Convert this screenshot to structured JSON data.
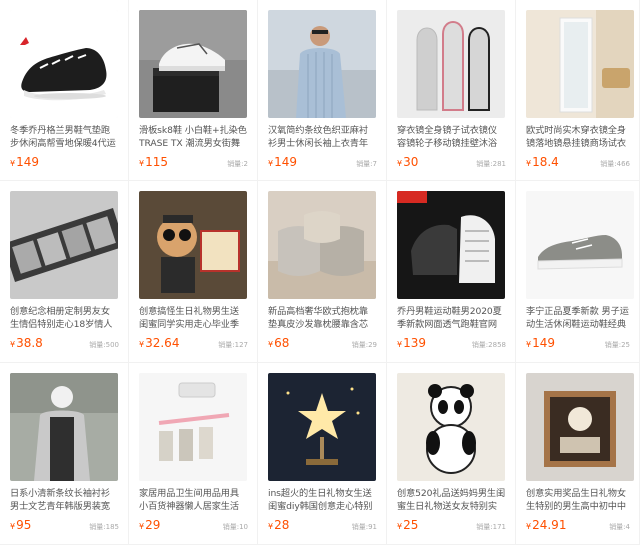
{
  "products": [
    {
      "title": "冬季乔丹格兰男鞋气垫跑步休闲高帮雪地保暖4代运动男加绒棉",
      "currency": "¥",
      "price": "149",
      "sales": ""
    },
    {
      "title": "滑板sk8鞋 小白鞋+扎染色TRASE TX 潮流男女街舞帆布休",
      "currency": "¥",
      "price": "115",
      "sales": "销量:2"
    },
    {
      "title": "汉氧简约条纹色织亚麻衬衫男士休闲长袖上衣青年棉麻修身型衬",
      "currency": "¥",
      "price": "149",
      "sales": "销量:7"
    },
    {
      "title": "穿衣镜全身镜子试衣镜仪容镜轮子移动镜挂壁沐浴镜简约现代经",
      "currency": "¥",
      "price": "30",
      "sales": "销量:281"
    },
    {
      "title": "欧式时尚实木穿衣镜全身镜落地镜悬挂镜商场试衣镜试鞋镜大壁",
      "currency": "¥",
      "price": "18.4",
      "sales": "销量:466"
    },
    {
      "title": "创意纪念相册定制男友女生情侣特别走心18岁情人抖音热门生",
      "currency": "¥",
      "price": "38.8",
      "sales": "销量:500"
    },
    {
      "title": "创意搞怪生日礼物男生送闺蜜同学实用走心毕业季礼品送男朋友",
      "currency": "¥",
      "price": "32.64",
      "sales": "销量:127"
    },
    {
      "title": "新品高档奢华欧式抱枕靠垫真皮沙发靠枕腰靠含芯大靠背抱枕套",
      "currency": "¥",
      "price": "68",
      "sales": "销量:29"
    },
    {
      "title": "乔丹男鞋运动鞋男2020夏季新款网面透气跑鞋官网男士休闲跑",
      "currency": "¥",
      "price": "139",
      "sales": "销量:2858"
    },
    {
      "title": "李宁正品夏季新款 男子运动生活休闲鞋运动鞋经典板鞋",
      "currency": "¥",
      "price": "149",
      "sales": "销量:25"
    },
    {
      "title": "日系小清新条纹长袖衬衫男士文艺青年韩版男装宽松休闲衬衣男",
      "currency": "¥",
      "price": "95",
      "sales": "销量:185"
    },
    {
      "title": "家居用品卫生间用品用具小百货神器懒人居家生活日用品实用小",
      "currency": "¥",
      "price": "29",
      "sales": "销量:10"
    },
    {
      "title": "ins超火的生日礼物女生送闺蜜diy韩国创意走心特别惊喜浪漫",
      "currency": "¥",
      "price": "28",
      "sales": "销量:91"
    },
    {
      "title": "创意520礼品送妈妈男生闺蜜生日礼物送女友特别实用家居",
      "currency": "¥",
      "price": "25",
      "sales": "销量:171"
    },
    {
      "title": "创意实用奖品生日礼物女生特别的男生高中初中中学生闺蜜友情纪",
      "currency": "¥",
      "price": "24.91",
      "sales": "销量:4"
    }
  ],
  "image_icons": [
    "black-sneaker-icon",
    "skate-shoe-box-icon",
    "striped-shirt-model-icon",
    "arched-mirrors-icon",
    "standing-mirror-icon",
    "photo-film-album-icon",
    "funny-figurine-icon",
    "satin-pillows-icon",
    "jordan-running-shoe-icon",
    "gray-sneaker-icon",
    "masked-man-shirt-icon",
    "hanging-rack-icon",
    "star-lamp-icon",
    "panda-figurine-icon",
    "wooden-gift-box-icon"
  ],
  "colors": {
    "price": "#ff5000",
    "title": "#555555",
    "sales": "#aaaaaa",
    "divider": "#f1f1f1"
  }
}
